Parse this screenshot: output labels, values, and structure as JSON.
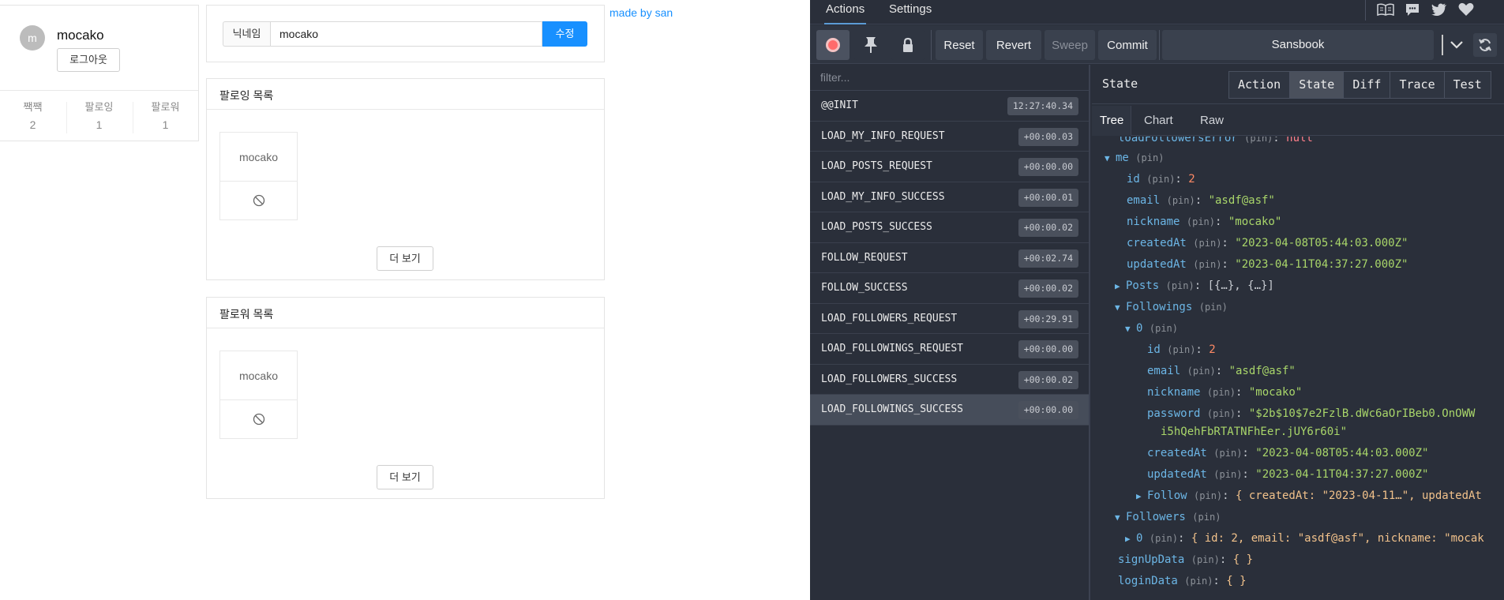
{
  "app": {
    "profile": {
      "avatar_initial": "m",
      "name": "mocako",
      "logout_label": "로그아웃",
      "stats": [
        {
          "label": "짹짹",
          "value": "2"
        },
        {
          "label": "팔로잉",
          "value": "1"
        },
        {
          "label": "팔로워",
          "value": "1"
        }
      ]
    },
    "nickname_form": {
      "label": "닉네임",
      "value": "mocako",
      "submit_label": "수정"
    },
    "following_list": {
      "title": "팔로잉 목록",
      "user": "mocako",
      "more_label": "더 보기"
    },
    "follower_list": {
      "title": "팔로워 목록",
      "user": "mocako",
      "more_label": "더 보기"
    },
    "made_by": "made by san"
  },
  "devtools": {
    "tabs": {
      "actions": "Actions",
      "settings": "Settings"
    },
    "toolbar": {
      "reset": "Reset",
      "revert": "Revert",
      "sweep": "Sweep",
      "commit": "Commit",
      "instance": "Sansbook"
    },
    "filter_placeholder": "filter...",
    "actions": [
      {
        "name": "@@INIT",
        "time": "12:27:40.34"
      },
      {
        "name": "LOAD_MY_INFO_REQUEST",
        "time": "+00:00.03"
      },
      {
        "name": "LOAD_POSTS_REQUEST",
        "time": "+00:00.00"
      },
      {
        "name": "LOAD_MY_INFO_SUCCESS",
        "time": "+00:00.01"
      },
      {
        "name": "LOAD_POSTS_SUCCESS",
        "time": "+00:00.02"
      },
      {
        "name": "FOLLOW_REQUEST",
        "time": "+00:02.74"
      },
      {
        "name": "FOLLOW_SUCCESS",
        "time": "+00:00.02"
      },
      {
        "name": "LOAD_FOLLOWERS_REQUEST",
        "time": "+00:29.91"
      },
      {
        "name": "LOAD_FOLLOWINGS_REQUEST",
        "time": "+00:00.00"
      },
      {
        "name": "LOAD_FOLLOWERS_SUCCESS",
        "time": "+00:00.02"
      },
      {
        "name": "LOAD_FOLLOWINGS_SUCCESS",
        "time": "+00:00.00"
      }
    ],
    "panel": {
      "title": "State",
      "tabs": [
        "Action",
        "State",
        "Diff",
        "Trace",
        "Test"
      ],
      "subtabs": [
        "Tree",
        "Chart",
        "Raw"
      ]
    },
    "pin": "(pin)",
    "tree": {
      "cut_key": "loadFollowersError",
      "cut_val": "null",
      "me_key": "me",
      "me": {
        "id": "2",
        "email": "\"asdf@asf\"",
        "nickname": "\"mocako\"",
        "createdAt": "\"2023-04-08T05:44:03.000Z\"",
        "updatedAt": "\"2023-04-11T04:37:27.000Z\"",
        "posts_key": "Posts",
        "posts_val": "[{…}, {…}]",
        "followings_key": "Followings",
        "idx0": "0"
      },
      "following0": {
        "id": "2",
        "email": "\"asdf@asf\"",
        "nickname": "\"mocako\"",
        "password_1": "\"$2b$10$7e2FzlB.dWc6aOrIBeb0.OnOWW",
        "password_2": "i5hQehFbRTATNFhEer.jUY6r60i\"",
        "createdAt": "\"2023-04-08T05:44:03.000Z\"",
        "updatedAt": "\"2023-04-11T04:37:27.000Z\"",
        "follow_key": "Follow",
        "follow_val": "{ createdAt: \"2023-04-11…\", updatedAt"
      },
      "followers_key": "Followers",
      "followers0_val": "{ id: 2, email: \"asdf@asf\", nickname: \"mocak",
      "signup_key": "signUpData",
      "signup_val": "{ }",
      "login_key": "loginData",
      "login_val": "{ }"
    }
  }
}
